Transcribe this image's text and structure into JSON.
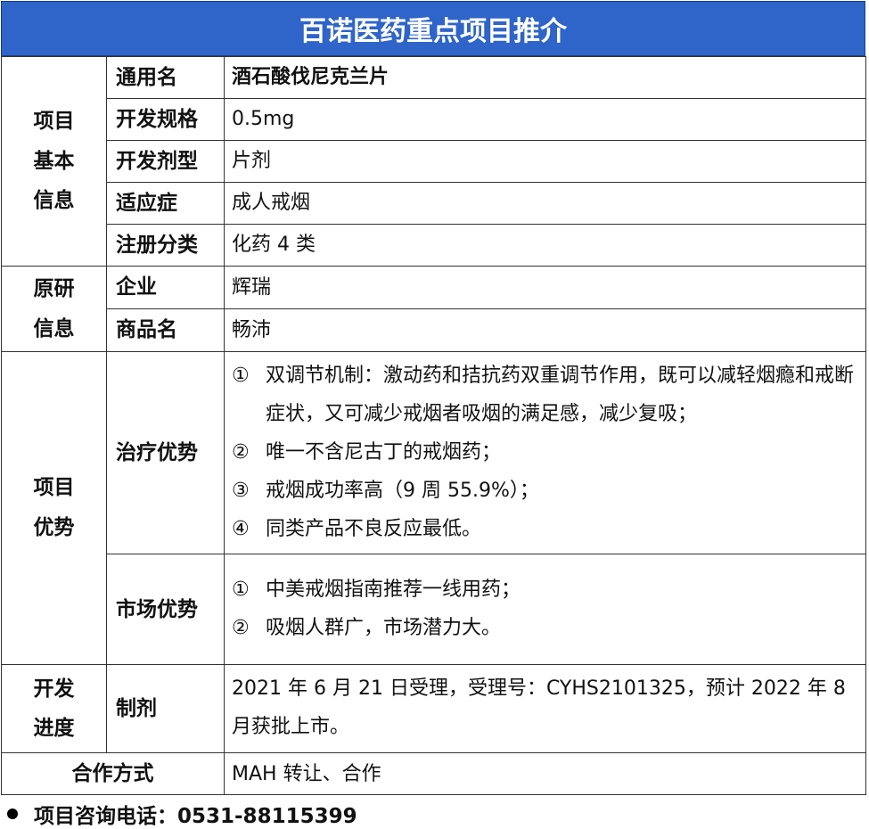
{
  "title": "百诺医药重点项目推介",
  "sections": {
    "basic": "项目\n基本\n信息",
    "origin": "原研\n信息",
    "advantage": "项目\n优势",
    "progress": "开发\n进度"
  },
  "basic_rows": [
    {
      "label": "通用名",
      "value": "酒石酸伐尼克兰片"
    },
    {
      "label": "开发规格",
      "value": "0.5mg"
    },
    {
      "label": "开发剂型",
      "value": "片剂"
    },
    {
      "label": "适应症",
      "value": "成人戒烟"
    },
    {
      "label": "注册分类",
      "value": "化药 4 类"
    }
  ],
  "origin_rows": [
    {
      "label": "企业",
      "value": "辉瑞"
    },
    {
      "label": "商品名",
      "value": "畅沛"
    }
  ],
  "treatment": {
    "label": "治疗优势",
    "items": [
      {
        "num": "①",
        "text": "双调节机制：激动药和拮抗药双重调节作用，既可以减轻烟瘾和戒断症状，又可减少戒烟者吸烟的满足感，减少复吸；"
      },
      {
        "num": "②",
        "text": "唯一不含尼古丁的戒烟药；"
      },
      {
        "num": "③",
        "text": "戒烟成功率高（9 周 55.9%）；"
      },
      {
        "num": "④",
        "text": "同类产品不良反应最低。"
      }
    ]
  },
  "market": {
    "label": "市场优势",
    "items": [
      {
        "num": "①",
        "text": "中美戒烟指南推荐一线用药；"
      },
      {
        "num": "②",
        "text": "吸烟人群广，市场潜力大。"
      }
    ]
  },
  "progress": {
    "label": "制剂",
    "value": "2021 年 6 月 21 日受理，受理号：CYHS2101325，预计 2022 年 8 月获批上市。"
  },
  "cooperation": {
    "label": "合作方式",
    "value": "MAH 转让、合作"
  },
  "contact": "项目咨询电话：0531-88115399"
}
